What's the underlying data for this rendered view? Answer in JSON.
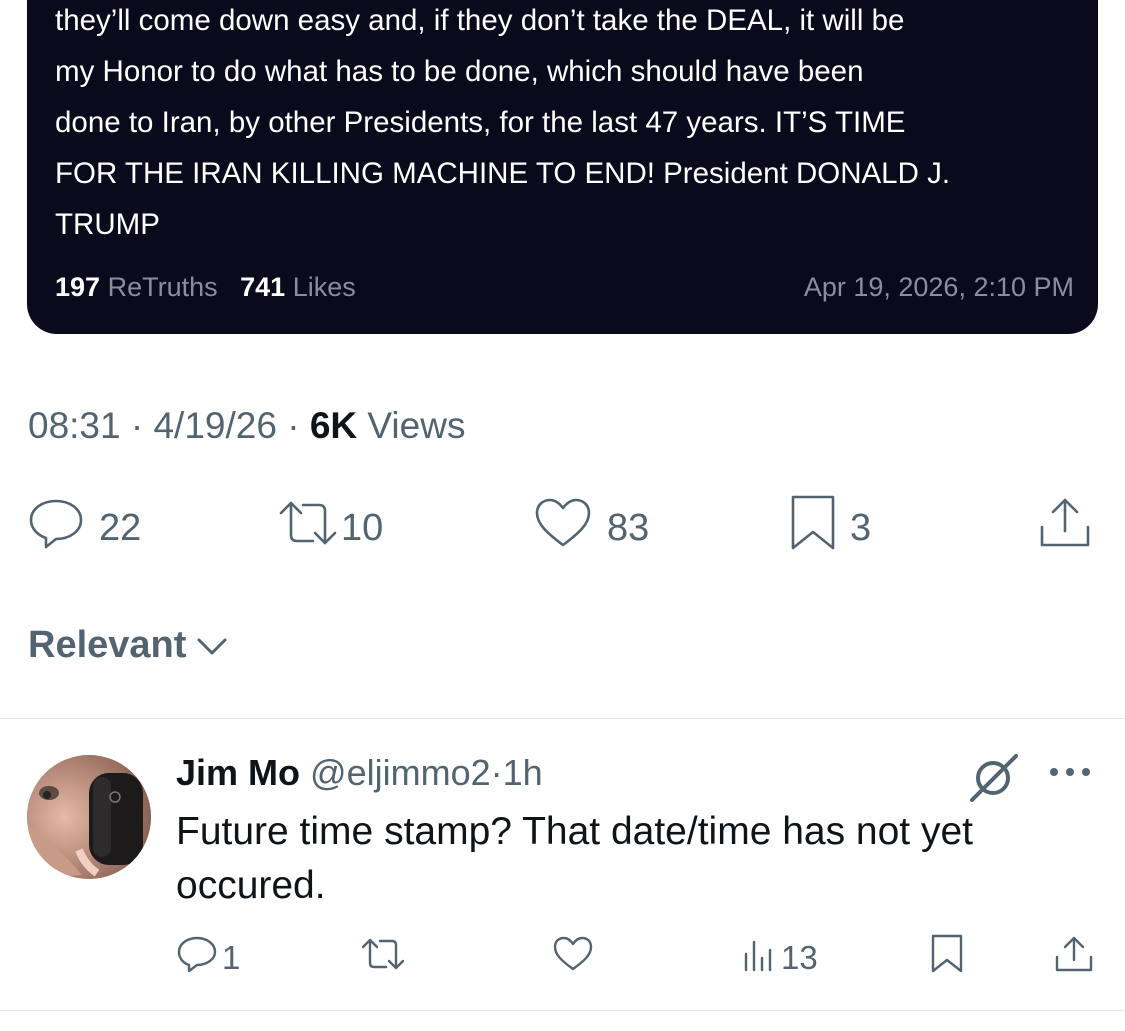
{
  "embedded_post": {
    "text": "they’ll come down easy and, if they don’t take the DEAL, it will be\nmy Honor to do what has to be done, which should have been\ndone to Iran, by other Presidents, for the last 47 years. IT’S TIME\nFOR THE IRAN KILLING MACHINE TO END! President DONALD J.\nTRUMP",
    "retruths_count": "197",
    "retruths_label": "ReTruths",
    "likes_count": "741",
    "likes_label": "Likes",
    "date": "Apr 19, 2026, 2:10 PM"
  },
  "post_meta": {
    "time": "08:31",
    "sep1": "·",
    "date": "4/19/26",
    "sep2": "·",
    "views_count": "6K",
    "views_label": "Views"
  },
  "post_actions": {
    "replies": "22",
    "reposts": "10",
    "likes": "83",
    "bookmarks": "3"
  },
  "sort": {
    "label": "Relevant"
  },
  "reply": {
    "name": "Jim Mo",
    "handle": "@eljimmo2",
    "sep": "·",
    "time": "1h",
    "text": "Future time stamp? That date/time has not yet occured.",
    "replies": "1",
    "views": "13"
  },
  "icons": {
    "reply": "reply-icon",
    "repost": "repost-icon",
    "like": "heart-icon",
    "bookmark": "bookmark-icon",
    "share": "share-icon",
    "views": "views-icon",
    "grok": "grok-icon",
    "more": "more-icon",
    "chevron": "chevron-down-icon"
  },
  "colors": {
    "card_bg": "#0b0a1c",
    "muted": "#536471",
    "text": "#0f1419"
  }
}
